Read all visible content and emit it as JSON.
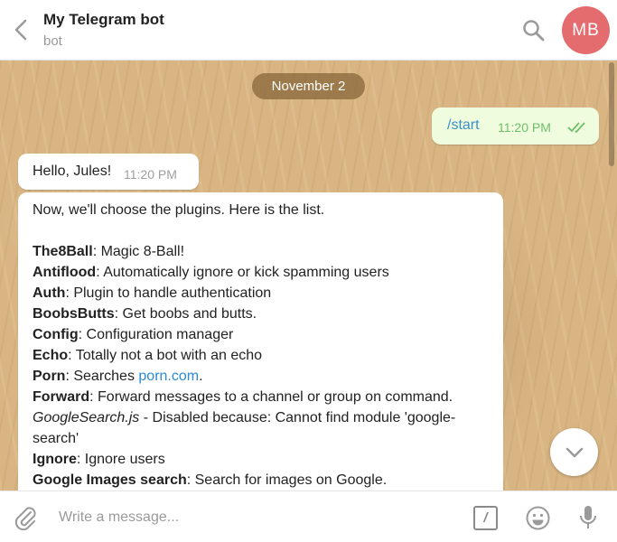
{
  "header": {
    "title": "My Telegram bot",
    "subtitle": "bot",
    "avatar_initials": "MB",
    "avatar_color": "#e46c6f",
    "icons": [
      "back-arrow-icon",
      "search-icon"
    ]
  },
  "chat": {
    "date_label": "November 2",
    "outgoing": {
      "text": "/start",
      "time": "11:20 PM",
      "status": "double-check-icon"
    },
    "greeting": {
      "text": "Hello, Jules!",
      "time": "11:20 PM"
    },
    "plugins_message": {
      "intro": "Now, we'll choose the plugins. Here is the list.",
      "items": [
        {
          "name": "The8Ball",
          "desc": ": Magic 8-Ball!"
        },
        {
          "name": "Antiflood",
          "desc": ": Automatically ignore or kick spamming users"
        },
        {
          "name": "Auth",
          "desc": ": Plugin to handle authentication"
        },
        {
          "name": "BoobsButts",
          "desc": ": Get boobs and butts."
        },
        {
          "name": "Config",
          "desc": ": Configuration manager"
        },
        {
          "name": "Echo",
          "desc": ": Totally not a bot with an echo"
        },
        {
          "name": "Porn",
          "desc": ": Searches ",
          "link": "porn.com",
          "after": "."
        },
        {
          "name": "Forward",
          "desc": ": Forward messages to a channel or group on command."
        },
        {
          "name": "GoogleSearch.js",
          "desc": " - Disabled because: Cannot find module 'google-",
          "desc2": "search'"
        },
        {
          "name": "Ignore",
          "desc": ": Ignore users"
        },
        {
          "name": "Google Images search",
          "desc": ": Search for images on Google."
        }
      ]
    }
  },
  "composer": {
    "placeholder": "Write a message...",
    "command_label": "/",
    "icons": [
      "attach-icon",
      "command-icon",
      "emoji-icon",
      "microphone-icon"
    ]
  },
  "colors": {
    "outgoing_bubble": "#effdde",
    "link": "#2a8ad3",
    "time_outgoing": "#6dbf6a"
  }
}
